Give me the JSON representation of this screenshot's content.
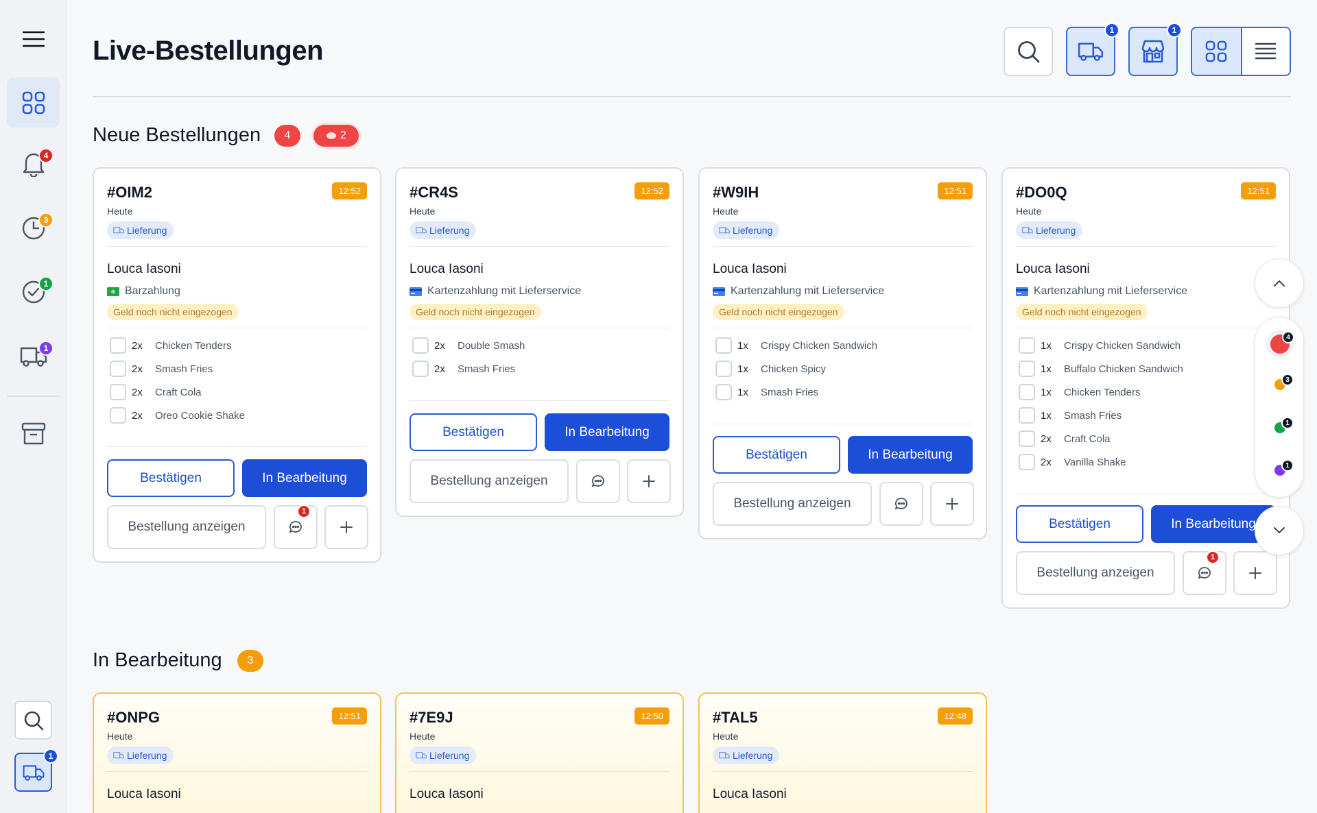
{
  "header": {
    "title": "Live-Bestellungen",
    "delivery_badge": "1",
    "store_badge": "1"
  },
  "sidebar": {
    "notif_badge": "4",
    "clock_badge": "3",
    "check_badge": "1",
    "truck_badge": "1",
    "bottom_truck_badge": "1"
  },
  "sections": {
    "new": {
      "title": "Neue Bestellungen",
      "count": "4",
      "chat_count": "2"
    },
    "processing": {
      "title": "In Bearbeitung",
      "count": "3"
    }
  },
  "labels": {
    "today": "Heute",
    "delivery": "Lieferung",
    "not_collected": "Geld noch nicht eingezogen",
    "confirm": "Bestätigen",
    "in_progress": "In Bearbeitung",
    "view_order": "Bestellung anzeigen"
  },
  "new_orders": [
    {
      "id": "#OIM2",
      "time": "12:52",
      "customer": "Louca Iasoni",
      "payment": "Barzahlung",
      "chat_badge": "1",
      "items": [
        {
          "qty": "2x",
          "name": "Chicken Tenders"
        },
        {
          "qty": "2x",
          "name": "Smash Fries"
        },
        {
          "qty": "2x",
          "name": "Craft Cola"
        },
        {
          "qty": "2x",
          "name": "Oreo Cookie Shake"
        }
      ]
    },
    {
      "id": "#CR4S",
      "time": "12:52",
      "customer": "Louca Iasoni",
      "payment": "Kartenzahlung mit Lieferservice",
      "items": [
        {
          "qty": "2x",
          "name": "Double Smash"
        },
        {
          "qty": "2x",
          "name": "Smash Fries"
        }
      ]
    },
    {
      "id": "#W9IH",
      "time": "12:51",
      "customer": "Louca Iasoni",
      "payment": "Kartenzahlung mit Lieferservice",
      "items": [
        {
          "qty": "1x",
          "name": "Crispy Chicken Sandwich"
        },
        {
          "qty": "1x",
          "name": "Chicken Spicy"
        },
        {
          "qty": "1x",
          "name": "Smash Fries"
        }
      ]
    },
    {
      "id": "#DO0Q",
      "time": "12:51",
      "customer": "Louca Iasoni",
      "payment": "Kartenzahlung mit Lieferservice",
      "chat_badge": "1",
      "items": [
        {
          "qty": "1x",
          "name": "Crispy Chicken Sandwich"
        },
        {
          "qty": "1x",
          "name": "Buffalo Chicken Sandwich"
        },
        {
          "qty": "1x",
          "name": "Chicken Tenders"
        },
        {
          "qty": "1x",
          "name": "Smash Fries"
        },
        {
          "qty": "2x",
          "name": "Craft Cola"
        },
        {
          "qty": "2x",
          "name": "Vanilla Shake"
        }
      ]
    }
  ],
  "processing_orders": [
    {
      "id": "#ONPG",
      "time": "12:51",
      "customer": "Louca Iasoni"
    },
    {
      "id": "#7E9J",
      "time": "12:50",
      "customer": "Louca Iasoni"
    },
    {
      "id": "#TAL5",
      "time": "12:48",
      "customer": "Louca Iasoni"
    }
  ],
  "rail": {
    "red_count": "4",
    "orange_count": "3",
    "green_count": "1",
    "purple_count": "1"
  },
  "colors": {
    "accent": "#1d4ed8",
    "badge_red": "#dc2626",
    "badge_orange": "#f59e0b",
    "badge_green": "#16a34a",
    "badge_purple": "#7c3aed"
  }
}
